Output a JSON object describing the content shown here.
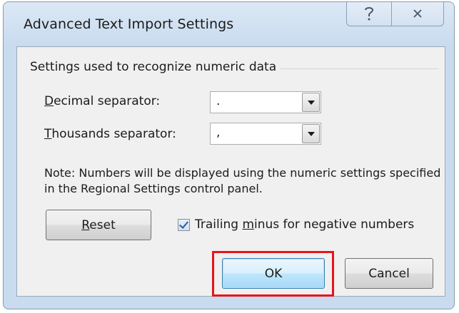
{
  "window": {
    "title": "Advanced Text Import Settings",
    "help_icon": "question-mark-icon",
    "close_icon": "close-icon"
  },
  "group": {
    "label": "Settings used to recognize numeric data"
  },
  "decimal": {
    "label_prefix": "D",
    "label_rest": "ecimal separator:",
    "value": "."
  },
  "thousands": {
    "label_prefix": "T",
    "label_rest": "housands separator:",
    "value": ","
  },
  "note": {
    "text": "Note: Numbers will be displayed using the numeric settings specified in the Regional Settings control panel."
  },
  "reset": {
    "label_prefix": "R",
    "label_rest": "eset"
  },
  "trailing_minus": {
    "label_before": "Trailing ",
    "label_accel": "m",
    "label_after": "inus for negative numbers",
    "checked": true
  },
  "buttons": {
    "ok": "OK",
    "cancel": "Cancel"
  },
  "colors": {
    "highlight": "#e8141b",
    "title_bar": "#c8dbef"
  }
}
